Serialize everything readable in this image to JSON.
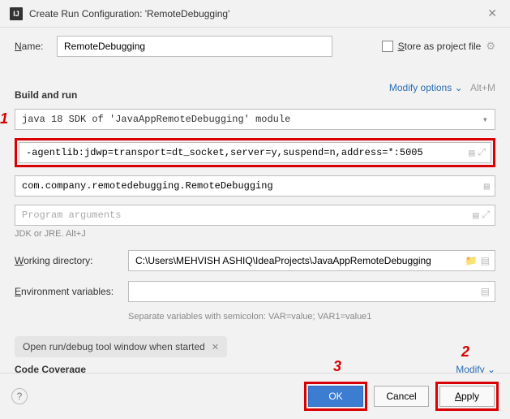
{
  "titlebar": {
    "app_icon": "IJ",
    "title": "Create Run Configuration: 'RemoteDebugging'"
  },
  "name": {
    "label": "Name:",
    "value": "RemoteDebugging"
  },
  "store": {
    "label": "Store as project file"
  },
  "build_run": {
    "title": "Build and run",
    "modify": "Modify options",
    "alt_hint": "Alt+M",
    "sdk_value": "java 18",
    "sdk_hint": "SDK of 'JavaAppRemoteDebugging' module",
    "vm_options": "-agentlib:jdwp=transport=dt_socket,server=y,suspend=n,address=*:5005",
    "main_class": "com.company.remotedebugging.RemoteDebugging",
    "program_args_placeholder": "Program arguments",
    "jdk_hint": "JDK or JRE. Alt+J"
  },
  "working_dir": {
    "label": "Working directory:",
    "value": "C:\\Users\\MEHVISH ASHIQ\\IdeaProjects\\JavaAppRemoteDebugging"
  },
  "env": {
    "label": "Environment variables:",
    "value": "",
    "hint": "Separate variables with semicolon: VAR=value; VAR1=value1"
  },
  "chip": {
    "label": "Open run/debug tool window when started"
  },
  "code_coverage": {
    "title": "Code Coverage",
    "modify": "Modify"
  },
  "annotations": {
    "one": "1",
    "two": "2",
    "three": "3"
  },
  "footer": {
    "ok": "OK",
    "cancel": "Cancel",
    "apply": "Apply"
  }
}
